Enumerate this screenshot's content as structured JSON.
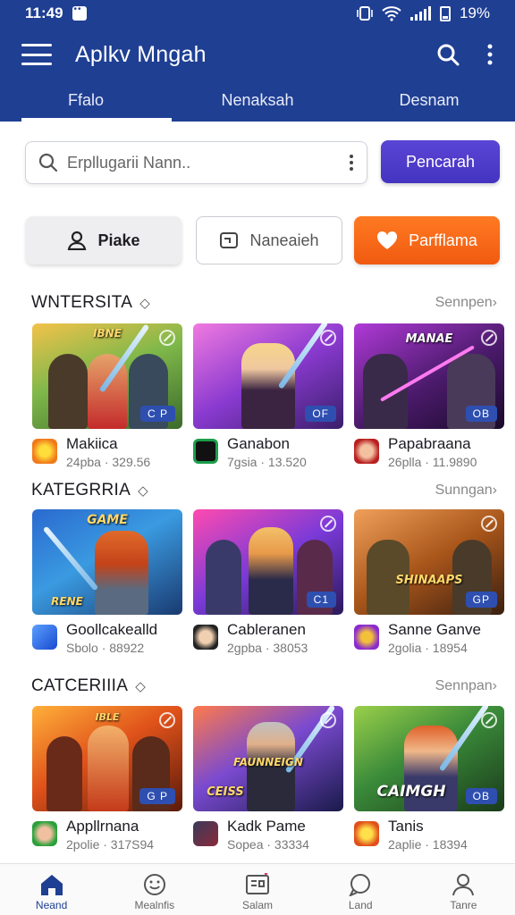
{
  "status_bar": {
    "time": "11:49",
    "battery": "19%"
  },
  "app_bar": {
    "title": "Aplkv Mngah"
  },
  "tabs": [
    {
      "label": "Ffalo",
      "active": true
    },
    {
      "label": "Nenaksah",
      "active": false
    },
    {
      "label": "Desnam",
      "active": false
    }
  ],
  "search": {
    "placeholder": "Erpllugarii Nann..",
    "button_label": "Pencarah"
  },
  "chips": [
    {
      "label": "Piake"
    },
    {
      "label": "Naneaieh"
    },
    {
      "label": "Parfflama"
    }
  ],
  "sections": [
    {
      "title": "WNTERSITA",
      "see_more": "Sennpen",
      "items": [
        {
          "name": "Makiica",
          "sub": "24pba · 329.56",
          "badge": "C P",
          "overlay": "IBNE"
        },
        {
          "name": "Ganabon",
          "sub": "7gsia · 13.520",
          "badge": "OF",
          "overlay": ""
        },
        {
          "name": "Papabraana",
          "sub": "26plla · 11.9890",
          "badge": "OB",
          "overlay": "MANAE"
        }
      ]
    },
    {
      "title": "KATEGRRIA",
      "see_more": "Sunngan",
      "items": [
        {
          "name": "Goollcakealld",
          "sub": "Sbolo · 88922",
          "badge": "",
          "overlay": "GAME",
          "overlay2": "RENE"
        },
        {
          "name": "Cableranen",
          "sub": "2gpba · 38053",
          "badge": "C1",
          "overlay": ""
        },
        {
          "name": "Sanne Ganve",
          "sub": "2golia · 18954",
          "badge": "GP",
          "overlay": "SHINAAPS"
        }
      ]
    },
    {
      "title": "CATCERIIIA",
      "see_more": "Sennpan",
      "items": [
        {
          "name": "Appllrnana",
          "sub": "2polie · 317S94",
          "badge": "G P",
          "overlay": "IBLE"
        },
        {
          "name": "Kadk Pame",
          "sub": "Sopea · 33334",
          "badge": "",
          "overlay": "FAUNNEIGN",
          "overlay2": "CEISS"
        },
        {
          "name": "Tanis",
          "sub": "2aplie · 18394",
          "badge": "OB",
          "overlay": "CAIMGH"
        }
      ]
    }
  ],
  "bottom_nav": [
    {
      "label": "Neand",
      "icon": "home-icon",
      "active": true
    },
    {
      "label": "Mealnfis",
      "icon": "smiley-icon",
      "active": false
    },
    {
      "label": "Salam",
      "icon": "board-icon",
      "active": false
    },
    {
      "label": "Land",
      "icon": "chat-icon",
      "active": false
    },
    {
      "label": "Tanre",
      "icon": "profile-icon",
      "active": false
    }
  ],
  "colors": {
    "primary": "#1f3f93",
    "search_button": "#4a3bc9",
    "accent_orange": "#f26a18"
  }
}
